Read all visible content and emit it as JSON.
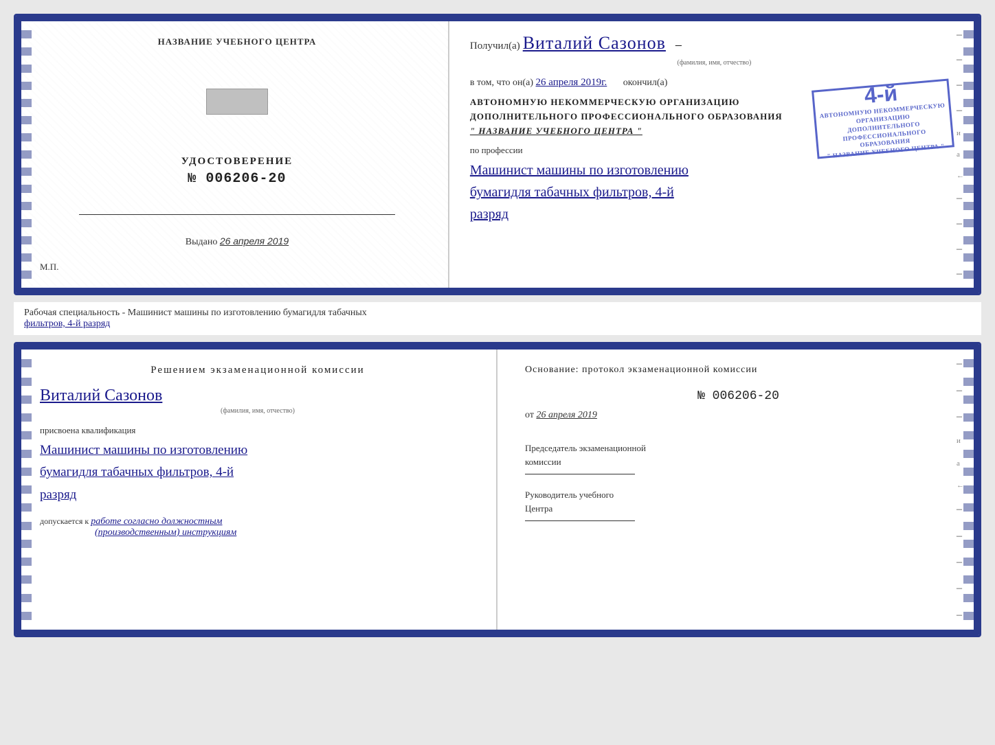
{
  "top_cert": {
    "left": {
      "school_label": "НАЗВАНИЕ УЧЕБНОГО ЦЕНТРА",
      "udostoverenie_label": "УДОСТОВЕРЕНИЕ",
      "cert_number": "№ 006206-20",
      "vydano_prefix": "Выдано",
      "vydano_date": "26 апреля 2019",
      "mp_label": "М.П."
    },
    "right": {
      "poluchil_prefix": "Получил(а)",
      "recipient_name": "Виталий Сазонов",
      "fio_subtitle": "(фамилия, имя, отчество)",
      "dash": "–",
      "vtom_prefix": "в том, что он(а)",
      "vtom_date": "26 апреля 2019г.",
      "okonchil": "окончил(а)",
      "org_line1": "АВТОНОМНУЮ НЕКОММЕРЧЕСКУЮ ОРГАНИЗАЦИЮ",
      "org_line2": "ДОПОЛНИТЕЛЬНОГО ПРОФЕССИОНАЛЬНОГО ОБРАЗОВАНИЯ",
      "org_name": "\" НАЗВАНИЕ УЧЕБНОГО ЦЕНТРА \"",
      "po_professii": "по профессии",
      "profession_line1": "Машинист машины по изготовлению",
      "profession_line2": "бумагидля табачных фильтров, 4-й",
      "profession_line3": "разряд"
    }
  },
  "middle": {
    "text_prefix": "Рабочая специальность - Машинист машины по изготовлению бумагидля табачных",
    "text_underline": "фильтров, 4-й разряд"
  },
  "bottom_cert": {
    "left": {
      "resheniyem_title": "Решением  экзаменационной  комиссии",
      "recipient_name": "Виталий Сазонов",
      "fio_subtitle": "(фамилия, имя, отчество)",
      "prisvoena": "присвоена квалификация",
      "qual_line1": "Машинист машины по изготовлению",
      "qual_line2": "бумагидля табачных фильтров, 4-й",
      "qual_line3": "разряд",
      "dopuskaetsya_prefix": "допускается к",
      "dopuskaetsya_val": "работе согласно должностным",
      "dopuskaetsya_val2": "(производственным) инструкциям"
    },
    "right": {
      "osnovanie_title": "Основание: протокол экзаменационной  комиссии",
      "protokol_number": "№  006206-20",
      "ot_prefix": "от",
      "ot_date": "26 апреля 2019",
      "predsedatel_label": "Председатель экзаменационной",
      "predsedatel_label2": "комиссии",
      "rukovoditel_label": "Руководитель учебного",
      "rukovoditel_label2": "Центра"
    }
  },
  "stamp": {
    "large_number": "4-й",
    "line1": "АВТОНОМНУЮ НЕКОММЕРЧЕСКУЮ ОРГАНИЗАЦИЮ",
    "line2": "ДОПОЛНИТЕЛЬНОГО ПРОФЕССИОНАЛЬНОГО",
    "line3": "ОБРАЗОВАНИЯ",
    "line4": "\" НАЗВАНИЕ УЧЕБНОГО ЦЕНТРА \""
  }
}
